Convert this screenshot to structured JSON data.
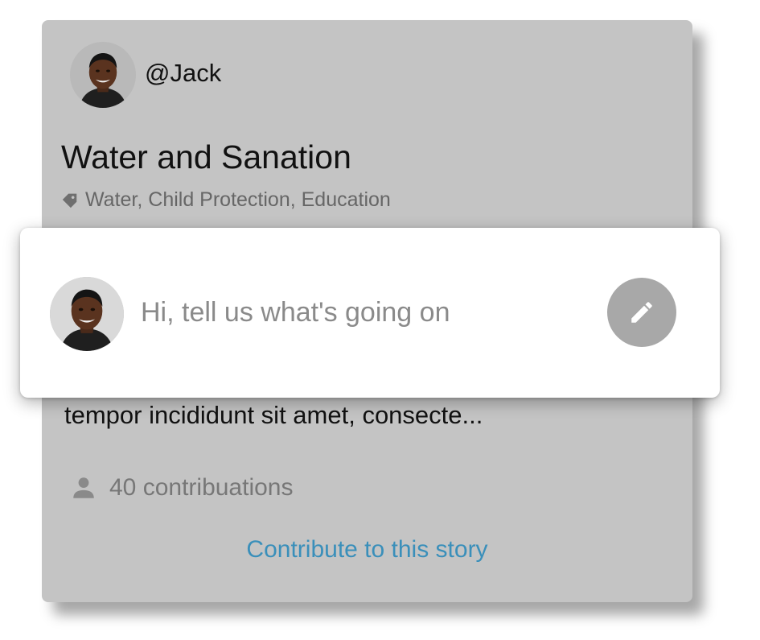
{
  "story": {
    "username": "@Jack",
    "title": "Water and Sanation",
    "tags": "Water, Child Protection, Education",
    "excerpt": "tempor incididunt sit amet, consecte...",
    "contributions": "40 contribuations",
    "contribute_link": "Contribute to this story"
  },
  "compose": {
    "placeholder": "Hi, tell us what's going on"
  },
  "icons": {
    "tag": "tag-icon",
    "person": "person-icon",
    "edit": "pencil-icon"
  },
  "colors": {
    "card_background": "#c4c4c4",
    "link": "#3a8fba",
    "edit_button": "#a8a8a8",
    "muted_text": "#777777"
  }
}
